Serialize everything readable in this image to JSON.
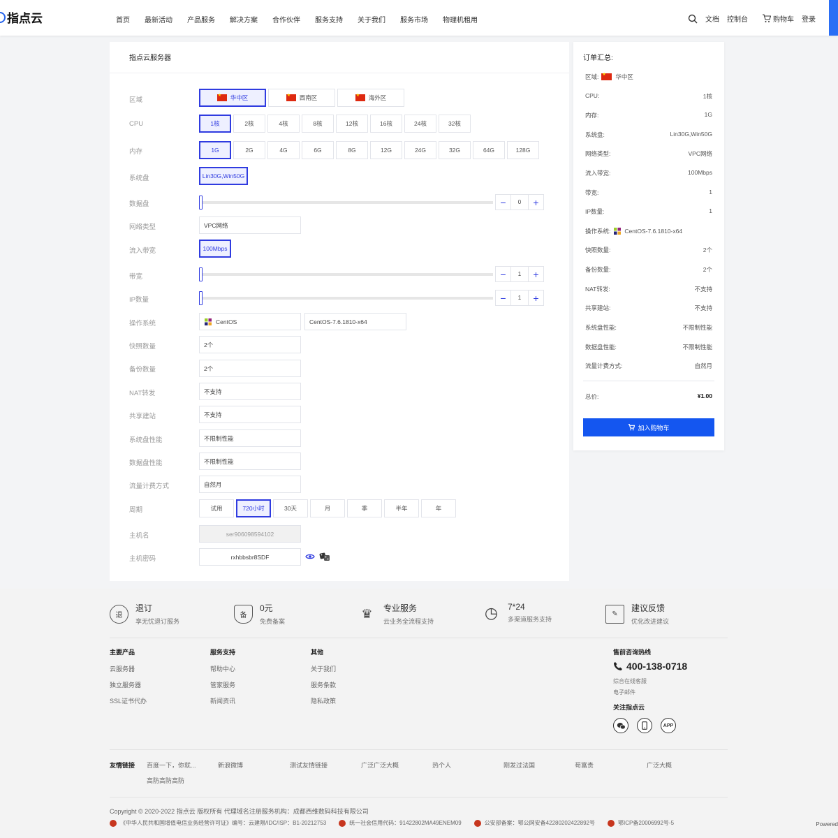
{
  "header": {
    "logo": "指点云",
    "nav": [
      "首页",
      "最新活动",
      "产品服务",
      "解决方案",
      "合作伙伴",
      "服务支持",
      "关于我们",
      "服务市场",
      "物理机租用"
    ],
    "right": [
      "文档",
      "控制台",
      "购物车",
      "登录"
    ]
  },
  "config": {
    "title": "指点云服务器",
    "labels": {
      "region": "区域",
      "cpu": "CPU",
      "mem": "内存",
      "sysdisk": "系统盘",
      "datadisk": "数据盘",
      "nettype": "网络类型",
      "inbw": "流入带宽",
      "bw": "带宽",
      "ip": "IP数量",
      "os": "操作系统",
      "snap": "快照数量",
      "backup": "备份数量",
      "nat": "NAT转发",
      "share": "共享建站",
      "sysperf": "系统盘性能",
      "dataperf": "数据盘性能",
      "billing": "流量计费方式",
      "period": "周期",
      "hostname": "主机名",
      "password": "主机密码"
    },
    "region": [
      "华中区",
      "西南区",
      "海外区"
    ],
    "cpu": [
      "1核",
      "2核",
      "4核",
      "8核",
      "12核",
      "16核",
      "24核",
      "32核"
    ],
    "mem": [
      "1G",
      "2G",
      "4G",
      "6G",
      "8G",
      "12G",
      "24G",
      "32G",
      "64G",
      "128G"
    ],
    "sysdisk": "Lin30G,Win50G",
    "datadisk": "0",
    "nettype": "VPC网络",
    "inbw": "100Mbps",
    "bw": "1",
    "ip": "1",
    "os_name": "CentOS",
    "os_ver": "CentOS-7.6.1810-x64",
    "snap": "2个",
    "backup": "2个",
    "nat": "不支持",
    "share": "不支持",
    "sysperf": "不限制性能",
    "dataperf": "不限制性能",
    "billing": "自然月",
    "period": [
      "试用",
      "720小时",
      "30天",
      "月",
      "季",
      "半年",
      "年"
    ],
    "hostname": "ser906098594102",
    "password": "rxhbbsbr8SDF"
  },
  "summary": {
    "title": "订单汇总:",
    "rows": [
      {
        "k": "区域:",
        "v": "华中区"
      },
      {
        "k": "CPU:",
        "v": "1核"
      },
      {
        "k": "内存:",
        "v": "1G"
      },
      {
        "k": "系统盘:",
        "v": "Lin30G,Win50G"
      },
      {
        "k": "网络类型:",
        "v": "VPC网络"
      },
      {
        "k": "流入带宽:",
        "v": "100Mbps"
      },
      {
        "k": "带宽:",
        "v": "1"
      },
      {
        "k": "IP数量:",
        "v": "1"
      },
      {
        "k": "操作系统:",
        "v": "CentOS-7.6.1810-x64"
      },
      {
        "k": "快照数量:",
        "v": "2个"
      },
      {
        "k": "备份数量:",
        "v": "2个"
      },
      {
        "k": "NAT转发:",
        "v": "不支持"
      },
      {
        "k": "共享建站:",
        "v": "不支持"
      },
      {
        "k": "系统盘性能:",
        "v": "不限制性能"
      },
      {
        "k": "数据盘性能:",
        "v": "不限制性能"
      },
      {
        "k": "流量计费方式:",
        "v": "自然月"
      }
    ],
    "total_label": "总价:",
    "total": "¥1.00",
    "cart_btn": "加入购物车"
  },
  "footer": {
    "features": [
      {
        "icon": "退",
        "t1": "退订",
        "t2": "享无忧退订服务"
      },
      {
        "icon": "备",
        "t1": "0元",
        "t2": "免费备案"
      },
      {
        "icon": "♛",
        "t1": "专业服务",
        "t2": "云业务全流程支持"
      },
      {
        "icon": "◷",
        "t1": "7*24",
        "t2": "多渠道服务支持"
      },
      {
        "icon": "✎",
        "t1": "建议反馈",
        "t2": "优化改进建议"
      }
    ],
    "cols": [
      {
        "h": "主要产品",
        "items": [
          "云服务器",
          "独立服务器",
          "SSL证书代办"
        ]
      },
      {
        "h": "服务支持",
        "items": [
          "帮助中心",
          "管家服务",
          "新闻资讯"
        ]
      },
      {
        "h": "其他",
        "items": [
          "关于我们",
          "服务条款",
          "隐私政策"
        ]
      }
    ],
    "hotline_title": "售前咨询热线",
    "hotline": "400-138-0718",
    "online": "综合在线客服",
    "email": "电子邮件",
    "follow": "关注指点云",
    "app": "APP",
    "links_label": "友情链接",
    "links": [
      "百度一下，你就...",
      "新浪微博",
      "测试友情链接",
      "广泛广泛大概",
      "热个人",
      "刚发过法国",
      "苟富贵",
      "广泛大概",
      "高防高防高防"
    ],
    "copyright": "Copyright © 2020-2022 指点云 版权所有  代理域名注册服务机构：成都西维数码科技有限公司",
    "licenses": [
      "《中华人民共和国增值电信业务经营许可证》编号：云建限/IDC/ISP：B1-20212753",
      "统一社会信用代码：91422802MA49ENEM09",
      "公安部备案：鄂公网安备42280202422892号",
      "鄂ICP备20006992号-5"
    ],
    "powered": "Powered"
  }
}
